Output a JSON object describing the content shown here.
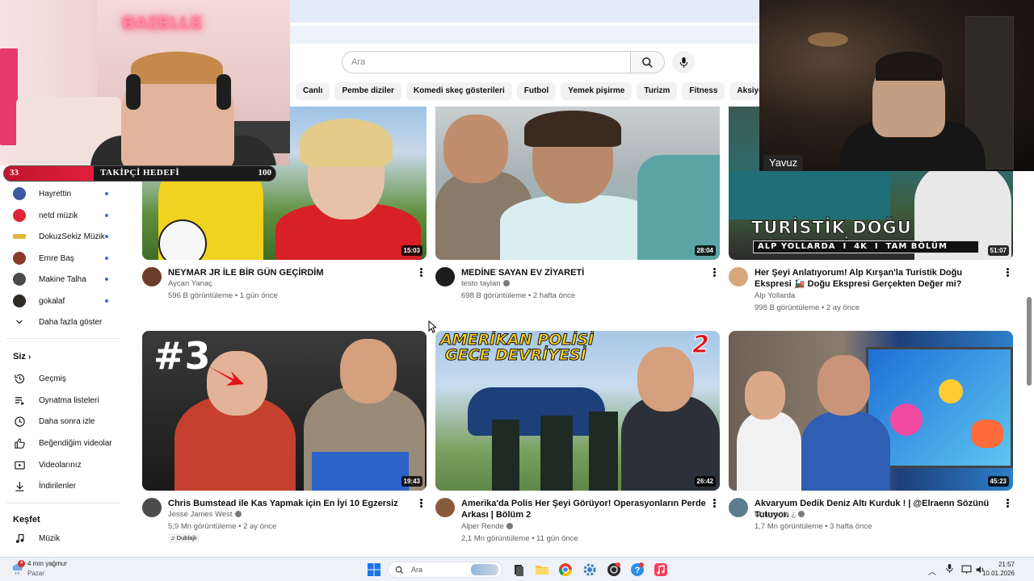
{
  "search": {
    "placeholder": "Ara"
  },
  "chips": [
    "Canlı",
    "Pembe diziler",
    "Komedi skeç gösterileri",
    "Futbol",
    "Yemek pişirme",
    "Turizm",
    "Fitness",
    "Aksiyon-macera"
  ],
  "overlay_left": {
    "neon_sign": "BAZELLE"
  },
  "goal": {
    "current": "33",
    "label": "TAKİPÇİ HEDEFİ",
    "target": "100",
    "progress_fraction": 0.33
  },
  "overlay_right": {
    "name": "Yavuz"
  },
  "sidebar": {
    "subscriptions": [
      {
        "label": "Hayrettin",
        "avatar_color": "#3b5aa0"
      },
      {
        "label": "netd müzik",
        "avatar_color": "#e0243b"
      },
      {
        "label": "DokuzSekiz Müzik",
        "avatar_color": "#e3b23c"
      },
      {
        "label": "Emre Baş",
        "avatar_color": "#8a3b2c"
      },
      {
        "label": "Makine Talha",
        "avatar_color": "#4a4a4a"
      },
      {
        "label": "gokalaf",
        "avatar_color": "#2e2a25"
      }
    ],
    "show_more": "Daha fazla göster",
    "you_heading": "Siz",
    "you_items": [
      "Geçmiş",
      "Oynatma listeleri",
      "Daha sonra izle",
      "Beğendiğim videolar",
      "Videolarınız",
      "İndirilenler"
    ],
    "explore_heading": "Keşfet",
    "explore_items": [
      "Müzik"
    ]
  },
  "videos": [
    {
      "title": "NEYMAR JR İLE BİR GÜN GEÇİRDİM",
      "channel": "Aycan Yanaç",
      "verified": false,
      "stats": "596 B görüntüleme • 1 gün önce",
      "duration": "15:03"
    },
    {
      "title": "MEDİNE SAYAN EV ZİYARETİ",
      "channel": "testo taylan",
      "verified": true,
      "stats": "698 B görüntüleme • 2 hafta önce",
      "duration": "28:04"
    },
    {
      "title": "Her Şeyi Anlatıyorum! Alp Kırşan'la Turistik Doğu Ekspresi 🚂 Doğu Ekspresi Gerçekten Değer mi?",
      "channel": "Alp Yollarda",
      "verified": false,
      "stats": "998 B görüntüleme • 2 ay önce",
      "duration": "51:07",
      "thumb_text": "TURİSTİK DOĞU EKSPRESİ",
      "thumb_sub": "ALP YOLLARDA  I  4K  I  TAM BÖLÜM"
    },
    {
      "title": "Chris Bumstead ile Kas Yapmak için En İyi 10 Egzersiz",
      "channel": "Jesse James West",
      "verified": true,
      "stats": "5,9 Mn görüntüleme • 2 ay önce",
      "duration": "19:43",
      "badge": "Dublajlı",
      "thumb_text": "#3"
    },
    {
      "title": "Amerika'da Polis Her Şeyi Görüyor! Operasyonların Perde Arkası | Bölüm 2",
      "channel": "Alper Rende",
      "verified": true,
      "stats": "2,1 Mn görüntüleme • 11 gün önce",
      "duration": "26:42",
      "thumb_text": "AMERİKAN POLİSİ",
      "thumb_sub": "GECE DEVRİYESİ",
      "thumb_num": "2"
    },
    {
      "title": "Akvaryum Dedik Deniz Altı Kurduk ! | @Elraenn Sözünü Tutuyor.",
      "channel": "Noluyo Ya ¿",
      "verified": true,
      "stats": "1,7 Mn görüntüleme • 3 hafta önce",
      "duration": "45:23"
    }
  ],
  "taskbar": {
    "weather": "4 mm yağmur",
    "weather_sub": "Pazar",
    "weather_badge": "4",
    "search": "Ara",
    "time": "21:57",
    "date": "10.01.2026"
  }
}
